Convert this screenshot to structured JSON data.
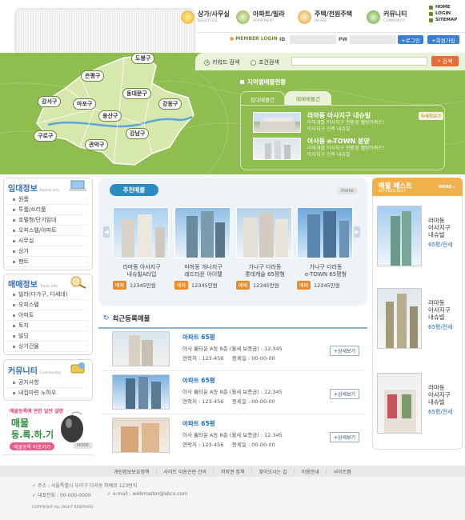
{
  "nav": {
    "items": [
      {
        "label": "아파트/빌라",
        "sub": "APARTMENT"
      },
      {
        "label": "주택/전원주택",
        "sub": "HOUSE"
      },
      {
        "label": "커뮤니티",
        "sub": "COMMUNITY"
      }
    ],
    "partial_1": "상가/사무실",
    "partial_1_sub": "BIZ/OFFICE",
    "util": [
      "HOME",
      "LOGIN",
      "SITEMAP"
    ]
  },
  "login": {
    "title": "MEMBER LOGIN",
    "id_label": "ID",
    "pw_label": "PW",
    "login_button": "+로그인",
    "join_button": "+회원가입"
  },
  "search": {
    "option_keyword": "키워드 검색",
    "option_condition": "조건검색",
    "button": "검색"
  },
  "map": {
    "districts": [
      "도봉구",
      "은평구",
      "강서구",
      "마포구",
      "동대문구",
      "용산구",
      "강동구",
      "구로구",
      "강남구",
      "관악구"
    ]
  },
  "region": {
    "title": "지역별매물현황",
    "tab_active": "임대매물건",
    "tab_inactive": "매매매물건",
    "listings": [
      {
        "title": "라마동 아사지구 내슈빌",
        "badge": "자세히보기",
        "desc1": "라마개발 아사지구 친환경 웰빙아파트!",
        "desc2": "아사지구 신축 내슈빌"
      },
      {
        "title": "아사동 e-TOWN 분양",
        "desc1": "라마개발 아사지구 친환경 웰빙아파트!",
        "desc2": "아사지구 신축 내슈빌"
      }
    ]
  },
  "sidebar": {
    "rental": {
      "title": "임대정보",
      "en": "Rental info",
      "items": [
        "원룸",
        "투룸/쓰리룸",
        "호텔형/단기임대",
        "오피스텔/아파트",
        "사무실",
        "상가",
        "펜트"
      ]
    },
    "trade": {
      "title": "매매정보",
      "en": "Trade info",
      "items": [
        "빌라(다가구, 다세대)",
        "오피스텔",
        "아파트",
        "토지",
        "빌딩",
        "상가건물"
      ]
    },
    "community": {
      "title": "커뮤니티",
      "en": "Community",
      "items": [
        "공지사항",
        "내집마련 노하우"
      ]
    },
    "promo": {
      "headline": "매물등록에 관한 일반 설명",
      "big1": "매물",
      "big2": "등.록.하.기",
      "button": "매물등록 바로가기",
      "more": "MORE"
    }
  },
  "recommend": {
    "tab": "추천매물",
    "more": "more",
    "cards": [
      {
        "line1": "라마동 아사지구",
        "line2": "내슈빌A타입",
        "price": "12345만원"
      },
      {
        "line1": "마하동 개나지구",
        "line2": "래드타운 아이팰",
        "price": "12345만원"
      },
      {
        "line1": "가나구 다라동",
        "line2": "롯데캐슬 65평형",
        "price": "12345만원"
      },
      {
        "line1": "가나구 다라동",
        "line2": "e-TOWN 65평형",
        "price": "12345만원"
      }
    ],
    "badge": "매매"
  },
  "recent": {
    "title": "최근등록매물",
    "rows": [
      {
        "title": "아파트 65평",
        "addr": "아사 흘타운 A동 8층 (월세 보증금) : 12.345",
        "contact": "연락처 : 123-456",
        "date": "등록일 : 00-00-00",
        "button": "+상세보기"
      },
      {
        "title": "아파트 65평",
        "addr": "아사 흘타운 A동 8층 (월세 보증금) : 12.345",
        "contact": "연락처 : 123-456",
        "date": "등록일 : 00-00-00",
        "button": "+상세보기"
      },
      {
        "title": "아파트 65평",
        "addr": "아사 흘타운 A동 8층 (월세 보증금) : 12.345",
        "contact": "연락처 : 123-456",
        "date": "등록일 : 00-00-00",
        "button": "+상세보기"
      }
    ]
  },
  "best": {
    "title": "매물 베스트",
    "sub": "OFFERED BEST",
    "more": "MORE",
    "cards": [
      {
        "l1": "라마동",
        "l2": "아사지구",
        "l3": "내슈빌",
        "size": "65평/전세"
      },
      {
        "l1": "라마동",
        "l2": "아사지구",
        "l3": "내슈빌",
        "size": "65평/전세"
      },
      {
        "l1": "라마동",
        "l2": "아사지구",
        "l3": "내슈빌",
        "size": "65평/전세"
      }
    ]
  },
  "footer": {
    "links": [
      "개인정보보호정책",
      "사이트 이용관련 건의",
      "저작권 정책",
      "찾아오시는 길",
      "이용안내",
      "사이트맵"
    ],
    "address": "주소 : 서울특별시 우리구 다라동 마배로 123번지",
    "phone": "대표전화 : 00-000-0000",
    "email": "e-mail : webmaster@abcx.com",
    "copyright": "COPYRIGHT ALL RIGHT RESERVED"
  }
}
